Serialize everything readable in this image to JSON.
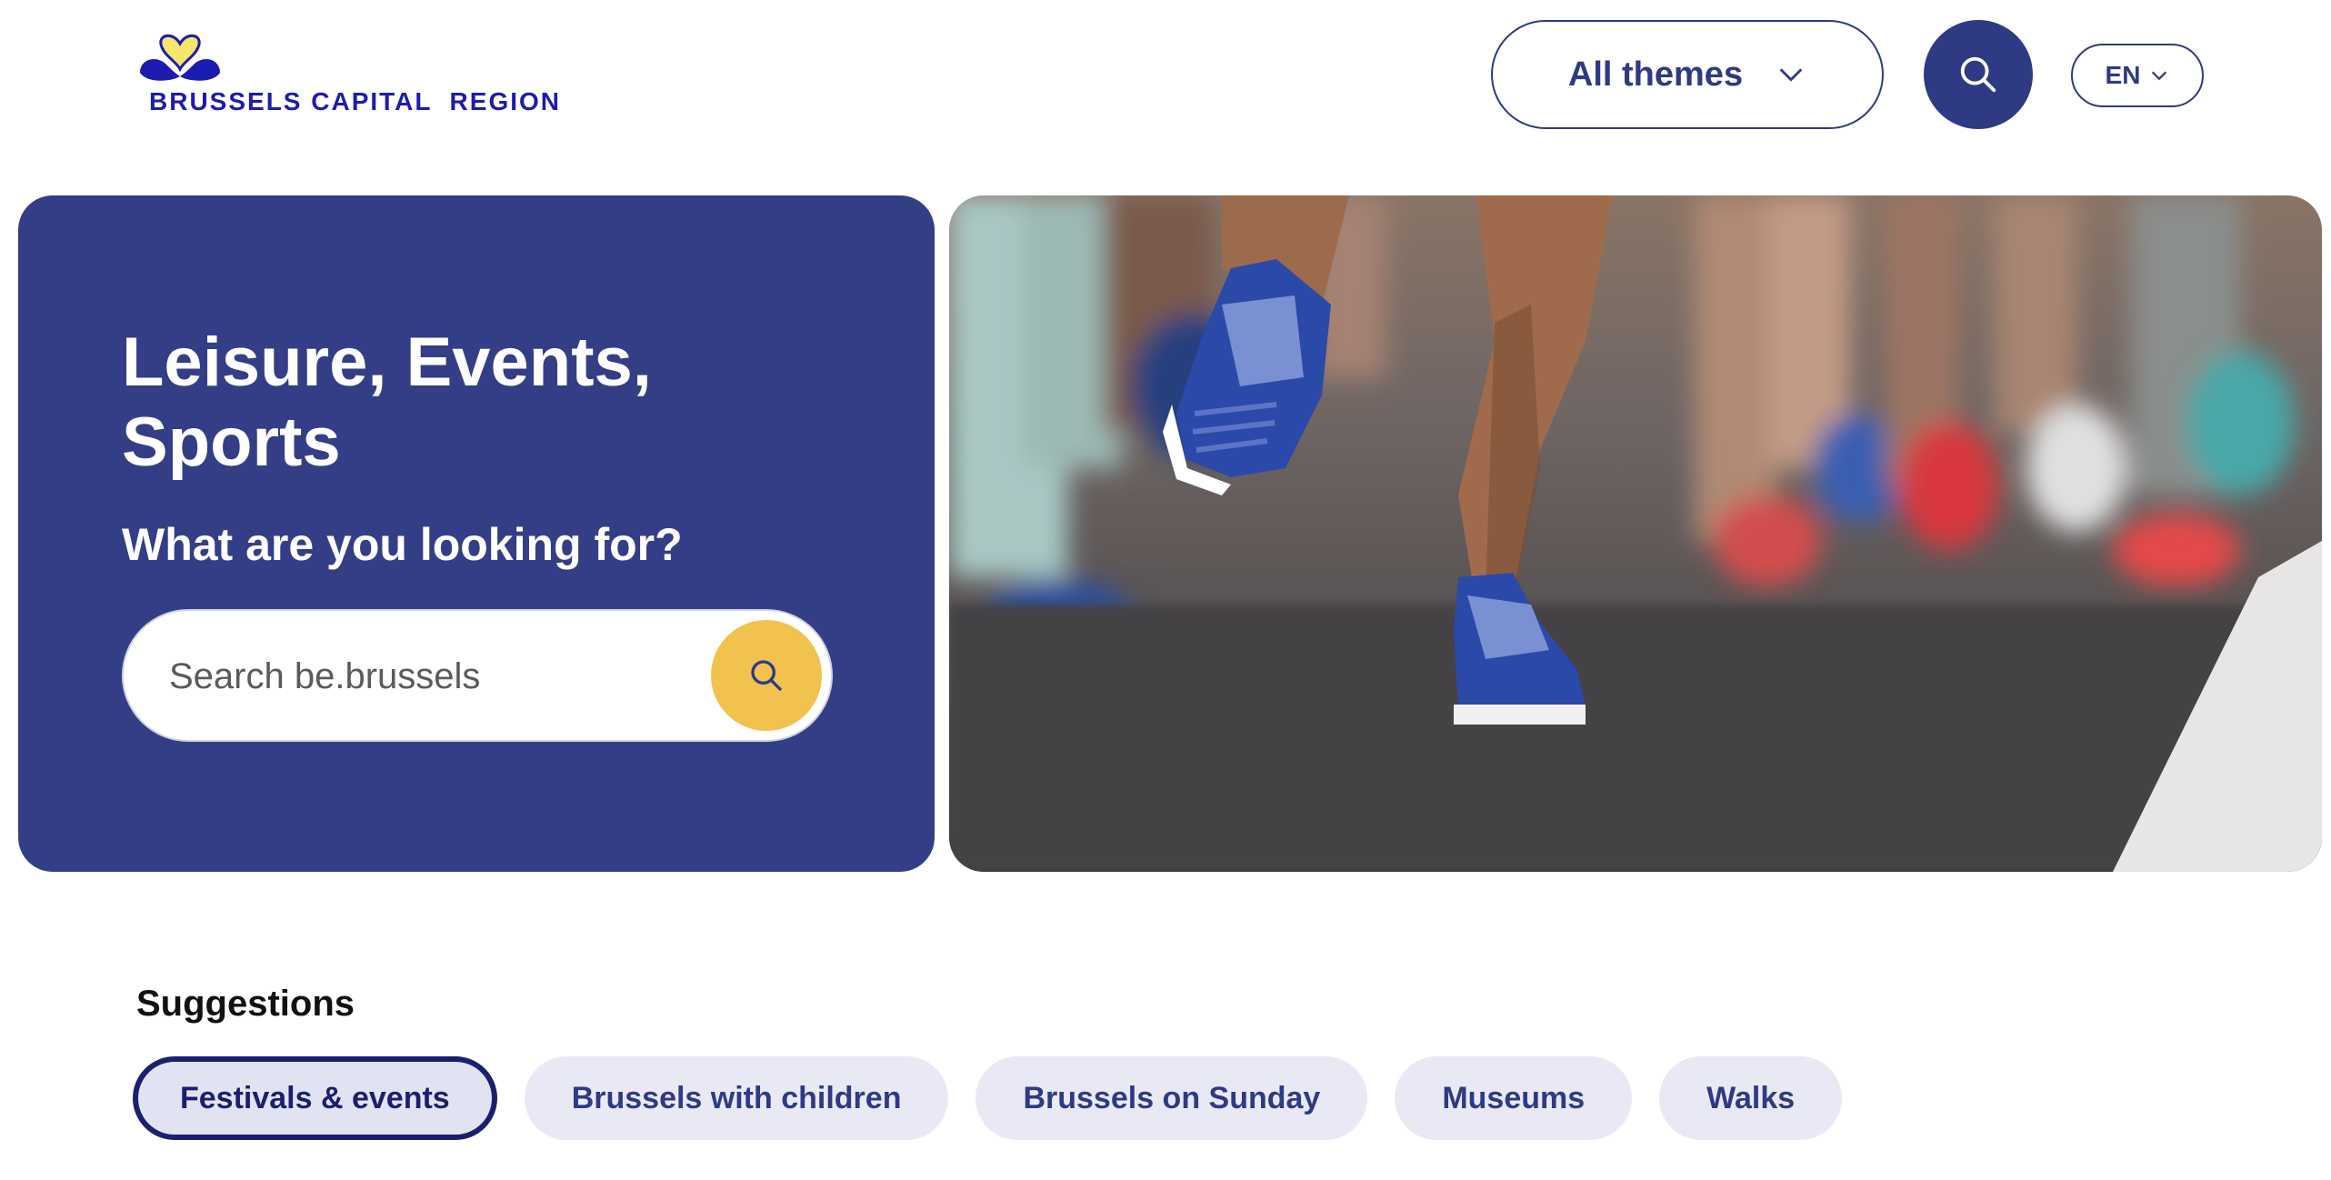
{
  "header": {
    "logo_text": "BRUSSELS CAPITAL  REGION",
    "themes_label": "All themes",
    "language": "EN",
    "icons": {
      "themes_chevron": "chevron-down-icon",
      "search": "search-icon",
      "lang_chevron": "chevron-down-icon"
    }
  },
  "hero": {
    "title": "Leisure, Events, Sports",
    "subtitle": "What are you looking for?",
    "search_placeholder": "Search be.brussels",
    "search_value": ""
  },
  "suggestions": {
    "title": "Suggestions",
    "items": [
      {
        "label": "Festivals & events",
        "active": true
      },
      {
        "label": "Brussels with children",
        "active": false
      },
      {
        "label": "Brussels on Sunday",
        "active": false
      },
      {
        "label": "Museums",
        "active": false
      },
      {
        "label": "Walks",
        "active": false
      }
    ]
  },
  "colors": {
    "brand_blue": "#343e86",
    "accent_yellow": "#f2c24f",
    "chip_bg": "#e8e9f4",
    "logo_blue": "#1c1cb0"
  }
}
